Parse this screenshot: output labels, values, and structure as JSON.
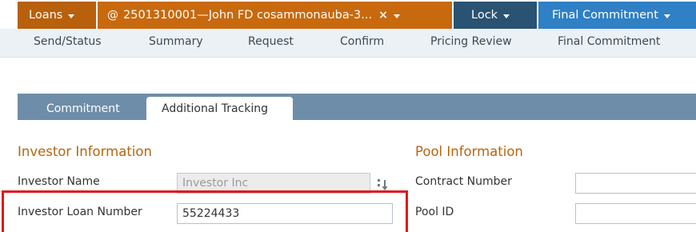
{
  "top_tabs": {
    "loans": "Loans",
    "file": "2501310001—John FD cosammonauba-3...",
    "close": "×",
    "lock": "Lock",
    "final": "Final Commitment"
  },
  "subnav": [
    "Send/Status",
    "Summary",
    "Request",
    "Confirm",
    "Pricing Review",
    "Final Commitment"
  ],
  "inner_tabs": [
    "Commitment",
    "Additional Tracking"
  ],
  "investor": {
    "title": "Investor Information",
    "name_label": "Investor Name",
    "name_value": "Investor Inc",
    "loan_number_label": "Investor Loan Number",
    "loan_number_value": "55224433"
  },
  "pool": {
    "title": "Pool Information",
    "contract_label": "Contract Number",
    "contract_value": "",
    "pool_id_label": "Pool ID",
    "pool_id_value": ""
  },
  "colors": {
    "loans_tab": "#b8600b",
    "file_tab": "#c8690e",
    "lock_tab": "#2a5272",
    "final_tab": "#2f80c4",
    "section_title": "#b6650f",
    "highlight": "#e0161b"
  }
}
